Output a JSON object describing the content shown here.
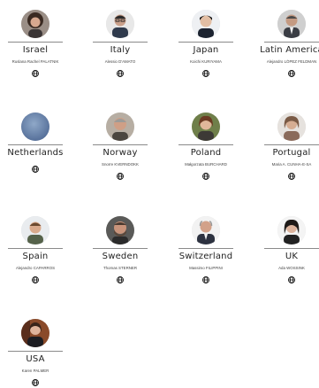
{
  "members": [
    {
      "country": "Israel",
      "person": "Ruslana Rachel PALATNIK",
      "photo": "portrait-woman-dark-hair"
    },
    {
      "country": "Italy",
      "person": "Alessio D'AMATO",
      "photo": "portrait-man-glasses"
    },
    {
      "country": "Japan",
      "person": "Koichi KURIYAMA",
      "photo": "portrait-man-dark-hair"
    },
    {
      "country": "Latin America",
      "person": "Alejandro LÓPEZ FELDMAN",
      "photo": "portrait-man-suit"
    },
    {
      "country": "Netherlands",
      "person": "",
      "photo": "placeholder-blue"
    },
    {
      "country": "Norway",
      "person": "Snorre KVERNDOKK",
      "photo": "portrait-man-grey-hair"
    },
    {
      "country": "Poland",
      "person": "Małgorzata BURCHARD",
      "photo": "portrait-woman-green"
    },
    {
      "country": "Portugal",
      "person": "Maria A. CUNHA-E-SA",
      "photo": "portrait-woman-curly-hair"
    },
    {
      "country": "Spain",
      "person": "Alejandro CAPARROS",
      "photo": "portrait-man-outdoor"
    },
    {
      "country": "Sweden",
      "person": "Thomas STERNER",
      "photo": "portrait-man-beard"
    },
    {
      "country": "Switzerland",
      "person": "Massimo FILIPPINI",
      "photo": "portrait-man-bald"
    },
    {
      "country": "UK",
      "person": "Ada WOSSINK",
      "photo": "portrait-woman-dark-hair"
    },
    {
      "country": "USA",
      "person": "Karen PALMER",
      "photo": "portrait-woman-red"
    }
  ],
  "icons": {
    "link": "globe-icon"
  }
}
